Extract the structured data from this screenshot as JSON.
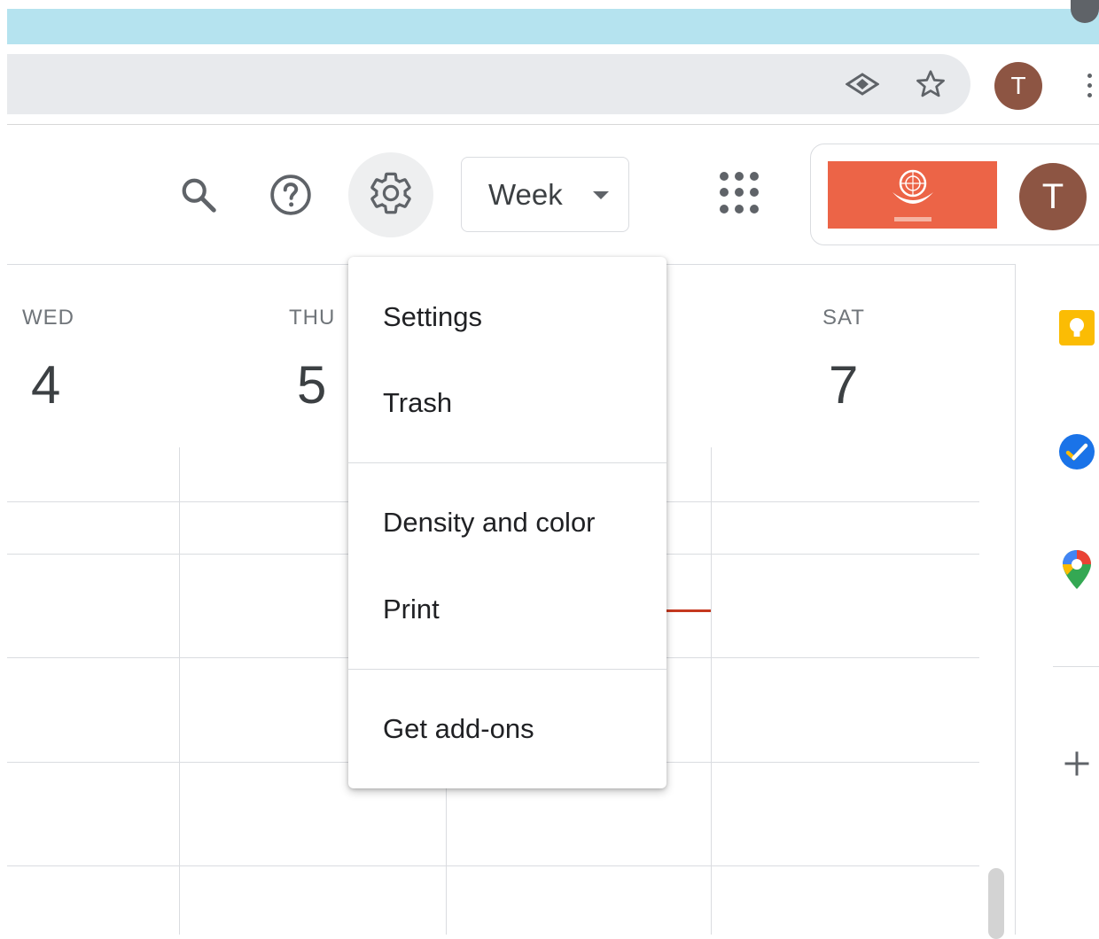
{
  "browser": {
    "profile_initial": "T",
    "icons": [
      "eye-icon",
      "star-icon",
      "more-vert-icon"
    ]
  },
  "header": {
    "view_selector_label": "Week",
    "account_initial": "T",
    "icons": [
      "search-icon",
      "help-icon",
      "settings-icon",
      "apps-icon"
    ]
  },
  "calendar": {
    "days": [
      {
        "name": "WED",
        "number": "4"
      },
      {
        "name": "THU",
        "number": "5"
      },
      {
        "name": "SAT",
        "number": "7"
      }
    ]
  },
  "settings_menu": {
    "items": [
      {
        "label": "Settings"
      },
      {
        "label": "Trash"
      },
      {
        "label": "Density and color"
      },
      {
        "label": "Print"
      },
      {
        "label": "Get add-ons"
      }
    ]
  },
  "side_panel": {
    "icons": [
      "keep-icon",
      "tasks-icon",
      "maps-icon",
      "add-icon"
    ]
  },
  "colors": {
    "tabstrip": "#b5e3ef",
    "avatar": "#8d5543",
    "org_logo": "#ec6447",
    "current_time_line": "#c5381f",
    "keep": "#fbbc04",
    "tasks": "#1a73e8"
  }
}
